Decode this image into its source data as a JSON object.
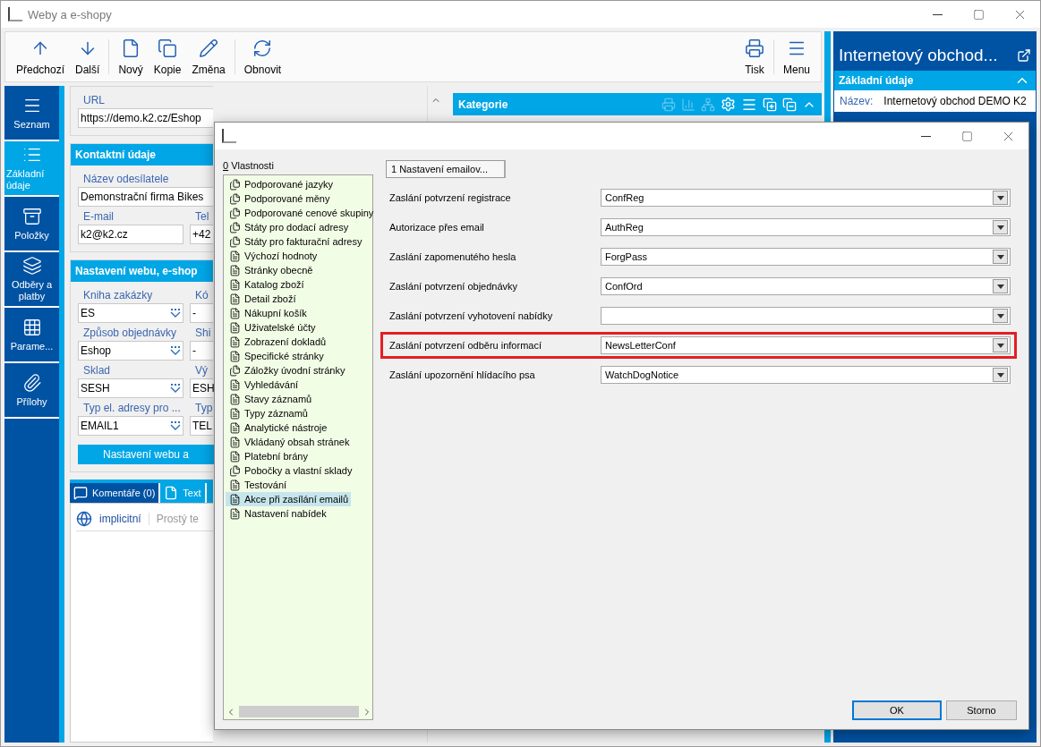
{
  "window": {
    "title": "Weby a e-shopy"
  },
  "toolbar": {
    "groups": [
      [
        {
          "label": "Předchozí"
        },
        {
          "label": "Další"
        }
      ],
      [
        {
          "label": "Nový"
        },
        {
          "label": "Kopie"
        },
        {
          "label": "Změna"
        }
      ],
      [
        {
          "label": "Obnovit"
        }
      ]
    ],
    "right_groups": [
      [
        {
          "label": "Tisk"
        }
      ],
      [
        {
          "label": "Menu"
        }
      ]
    ]
  },
  "nav": [
    {
      "label": "Seznam",
      "selected": false
    },
    {
      "label": "Základní údaje",
      "selected": true
    },
    {
      "label": "Položky",
      "selected": false
    },
    {
      "label": "Odběry a platby",
      "selected": false
    },
    {
      "label": "Parame...",
      "selected": false
    },
    {
      "label": "Přílohy",
      "selected": false
    }
  ],
  "form": {
    "sections": [
      {
        "rows": [
          [
            {
              "label": "URL",
              "value": "https://demo.k2.cz/Eshop",
              "kind": "text"
            }
          ]
        ]
      },
      {
        "title": "Kontaktní údaje",
        "rows": [
          [
            {
              "label": "Název odesílatele",
              "value": "Demonstrační firma Bikes",
              "kind": "text"
            }
          ],
          [
            {
              "label": "E-mail",
              "value": "k2@k2.cz",
              "kind": "text"
            },
            {
              "label": "Tel",
              "value": "+42",
              "kind": "text"
            }
          ]
        ]
      },
      {
        "title": "Nastavení webu, e-shop",
        "rows": [
          [
            {
              "label": "Kniha zakázky",
              "value": "ES",
              "kind": "combo"
            },
            {
              "label": "Kó",
              "value": "-",
              "kind": "text"
            }
          ],
          [
            {
              "label": "Způsob objednávky",
              "value": "Eshop",
              "kind": "combo"
            },
            {
              "label": "Shi",
              "value": "-",
              "kind": "text"
            }
          ],
          [
            {
              "label": "Sklad",
              "value": "SESH",
              "kind": "combo"
            },
            {
              "label": "Vý",
              "value": "ESH",
              "kind": "text"
            }
          ],
          [
            {
              "label": "Typ el. adresy pro ...",
              "value": "EMAIL1",
              "kind": "combo"
            },
            {
              "label": "Typ",
              "value": "TEL",
              "kind": "text"
            }
          ]
        ],
        "button": "Nastavení webu a"
      }
    ]
  },
  "comments": {
    "tabs": [
      {
        "label": "Komentáře (0)",
        "selected": true
      },
      {
        "label": "Text",
        "selected": false
      }
    ],
    "language": "implicitní",
    "format": "Prostý te"
  },
  "category_panel": {
    "title": "Kategorie"
  },
  "detail_panel": {
    "title": "Internetový obchod...",
    "section": "Základní údaje",
    "rows": [
      {
        "label": "Název:",
        "value": "Internetový obchod DEMO K2"
      }
    ]
  },
  "dialog": {
    "list_label": "0 Vlastnosti",
    "items": [
      {
        "label": "Podporované jazyky",
        "kind": "multi",
        "selected": false
      },
      {
        "label": "Podporované měny",
        "kind": "multi",
        "selected": false
      },
      {
        "label": "Podporované cenové skupiny",
        "kind": "multi",
        "selected": false
      },
      {
        "label": "Státy pro dodací adresy",
        "kind": "multi",
        "selected": false
      },
      {
        "label": "Státy pro fakturační adresy",
        "kind": "multi",
        "selected": false
      },
      {
        "label": "Výchozí hodnoty",
        "kind": "single",
        "selected": false
      },
      {
        "label": "Stránky obecně",
        "kind": "single",
        "selected": false
      },
      {
        "label": "Katalog zboží",
        "kind": "single",
        "selected": false
      },
      {
        "label": "Detail zboží",
        "kind": "single",
        "selected": false
      },
      {
        "label": "Nákupní košík",
        "kind": "single",
        "selected": false
      },
      {
        "label": "Uživatelské účty",
        "kind": "single",
        "selected": false
      },
      {
        "label": "Zobrazení dokladů",
        "kind": "single",
        "selected": false
      },
      {
        "label": "Specifické stránky",
        "kind": "single",
        "selected": false
      },
      {
        "label": "Záložky úvodní stránky",
        "kind": "multi",
        "selected": false
      },
      {
        "label": "Vyhledávání",
        "kind": "single",
        "selected": false
      },
      {
        "label": "Stavy záznamů",
        "kind": "single",
        "selected": false
      },
      {
        "label": "Typy záznamů",
        "kind": "single",
        "selected": false
      },
      {
        "label": "Analytické nástroje",
        "kind": "single",
        "selected": false
      },
      {
        "label": "Vkládaný obsah stránek",
        "kind": "single",
        "selected": false
      },
      {
        "label": "Platební brány",
        "kind": "single",
        "selected": false
      },
      {
        "label": "Pobočky a vlastní sklady",
        "kind": "multi",
        "selected": false
      },
      {
        "label": "Testování",
        "kind": "single",
        "selected": false
      },
      {
        "label": "Akce při zasílání emailů",
        "kind": "single",
        "selected": true
      },
      {
        "label": "Nastavení nabídek",
        "kind": "single",
        "selected": false
      }
    ],
    "tabs": [
      {
        "label": "1 Nastavení emailov...",
        "selected": true
      }
    ],
    "rows": [
      {
        "label": "Zaslání potvrzení registrace",
        "value": "ConfReg",
        "highlighted": false
      },
      {
        "label": "Autorizace přes email",
        "value": "AuthReg",
        "highlighted": false
      },
      {
        "label": "Zaslání zapomenutého hesla",
        "value": "ForgPass",
        "highlighted": false
      },
      {
        "label": "Zaslání potvrzení objednávky",
        "value": "ConfOrd",
        "highlighted": false
      },
      {
        "label": "Zaslání potvrzení vyhotovení nabídky",
        "value": "",
        "highlighted": false
      },
      {
        "label": "Zaslání potvrzení odběru informací",
        "value": "NewsLetterConf",
        "highlighted": true
      },
      {
        "label": "Zaslání upozornění hlídacího psa",
        "value": "WatchDogNotice",
        "highlighted": false
      }
    ],
    "buttons": [
      {
        "label": "OK",
        "default": true
      },
      {
        "label": "Storno",
        "default": false
      }
    ]
  }
}
